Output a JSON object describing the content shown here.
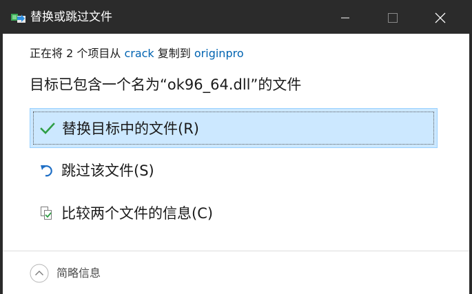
{
  "window": {
    "title": "替换或跳过文件",
    "icon": "file-transfer-icon",
    "controls": {
      "minimize_icon": "minimize-icon",
      "maximize_icon": "maximize-icon",
      "close_icon": "close-icon"
    }
  },
  "copy_info": {
    "prefix": "正在将 2 个项目从 ",
    "source": "crack",
    "middle": " 复制到 ",
    "destination": "originpro"
  },
  "headline": "目标已包含一个名为“ok96_64.dll”的文件",
  "options": [
    {
      "label": "替换目标中的文件(R)",
      "icon": "checkmark-icon",
      "selected": true
    },
    {
      "label": "跳过该文件(S)",
      "icon": "undo-arrow-icon",
      "selected": false
    },
    {
      "label": "比较两个文件的信息(C)",
      "icon": "compare-files-icon",
      "selected": false
    }
  ],
  "footer": {
    "details_label": "简略信息",
    "toggle_icon": "chevron-up-icon"
  },
  "colors": {
    "titlebar": "#2b2b2b",
    "link": "#0063b1",
    "selected_bg": "#cce8ff",
    "selected_border": "#99d1ff",
    "check_green": "#2e9e45",
    "undo_blue": "#1f6fc5"
  }
}
